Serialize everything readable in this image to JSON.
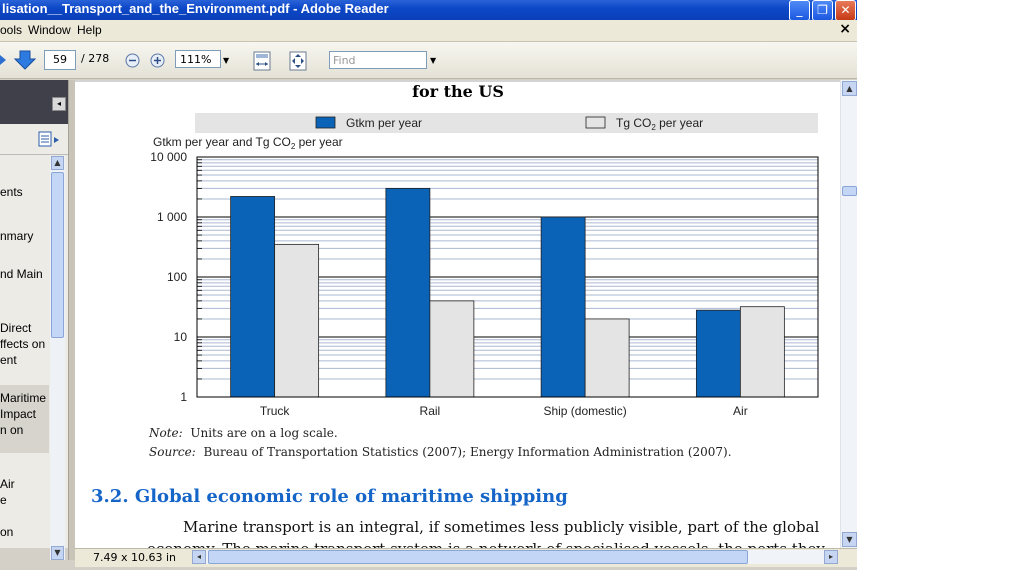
{
  "window": {
    "title": "lisation__Transport_and_the_Environment.pdf - Adobe Reader",
    "minimize": "_",
    "restore": "❐",
    "close": "✕"
  },
  "menu": {
    "items": [
      "ools",
      "Window",
      "Help"
    ],
    "close_doc": "×"
  },
  "toolbar": {
    "page_current": "59",
    "page_total": "/ 278",
    "zoom": "111%",
    "find_placeholder": "Find"
  },
  "sidebar": {
    "items": [
      {
        "text": "ents"
      },
      {
        "text": "nmary"
      },
      {
        "text": "nd Main"
      },
      {
        "text": " Direct"
      },
      {
        "text": "ffects on"
      },
      {
        "text": "ent"
      },
      {
        "text": "Maritime"
      },
      {
        "text": " Impact"
      },
      {
        "text": "n on"
      },
      {
        "text": "Air"
      },
      {
        "text": "e"
      },
      {
        "text": "on"
      }
    ]
  },
  "document": {
    "chart_title_partial": "for the US",
    "note_label": "Note:",
    "note_text": "Units are on a log scale.",
    "source_label": "Source:",
    "source_text": "Bureau of Transportation Statistics (2007); Energy Information Administration (2007).",
    "section_heading": "3.2. Global economic role of maritime shipping",
    "body_line1": "Marine transport is an integral, if sometimes less publicly visible, part of the global",
    "body_line2": "economy. The marine transport system is a network of specialised vessels, the ports they"
  },
  "chart_data": {
    "type": "bar",
    "ylabel_main": "Gtkm per year and Tg CO",
    "ylabel_sub": "2",
    "ylabel_tail": " per year",
    "yscale": "log",
    "ylim": [
      1,
      10000
    ],
    "yticks": [
      "10 000",
      "1 000",
      "100",
      "10",
      "1"
    ],
    "categories": [
      "Truck",
      "Rail",
      "Ship (domestic)",
      "Air"
    ],
    "series": [
      {
        "name": "Gtkm per year",
        "color": "#0b63b8",
        "values": [
          2200,
          3000,
          1000,
          28
        ]
      },
      {
        "name_main": "Tg CO",
        "name_sub": "2",
        "name_tail": " per year",
        "color": "#e4e4e4",
        "values": [
          350,
          40,
          20,
          32
        ]
      }
    ],
    "legend": "top",
    "grid": true
  },
  "status": {
    "page_size": "7.49 x 10.63 in"
  }
}
